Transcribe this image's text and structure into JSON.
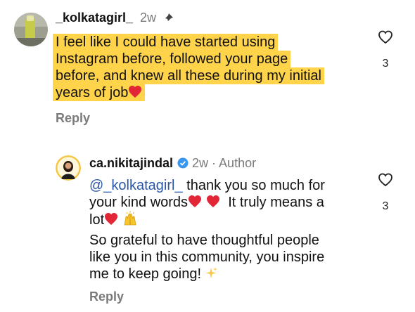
{
  "comment": {
    "username": "_kolkatagirl_",
    "time": "2w",
    "lines": [
      "I feel like I could have started using",
      "Instagram before, followed your page",
      "before, and knew all these during my initial",
      "years of job"
    ],
    "reply_label": "Reply",
    "likes": "3",
    "icons": [
      "pin-icon",
      "heart-emoji-icon",
      "heart-outline-icon"
    ]
  },
  "reply": {
    "username": "ca.nikitajindal",
    "time": "2w",
    "separator": "·",
    "author_label": "Author",
    "mention": "@_kolkatagirl_",
    "line1_rest": " thank you so much for",
    "line2": "your kind words",
    "line2_rest": "It truly means a",
    "line3": "lot",
    "para2_lines": [
      "So grateful to have thoughtful people",
      "like you in this community, you inspire",
      "me to keep going!"
    ],
    "reply_label": "Reply",
    "likes": "3",
    "icons": [
      "verified-badge-icon",
      "heart-emoji-icon",
      "raising-hands-icon",
      "sparkles-icon",
      "heart-outline-icon"
    ]
  },
  "colors": {
    "highlight": "#ffd34a",
    "mention": "#2a56a8",
    "verified": "#3797f0",
    "heart": "#e32636"
  }
}
